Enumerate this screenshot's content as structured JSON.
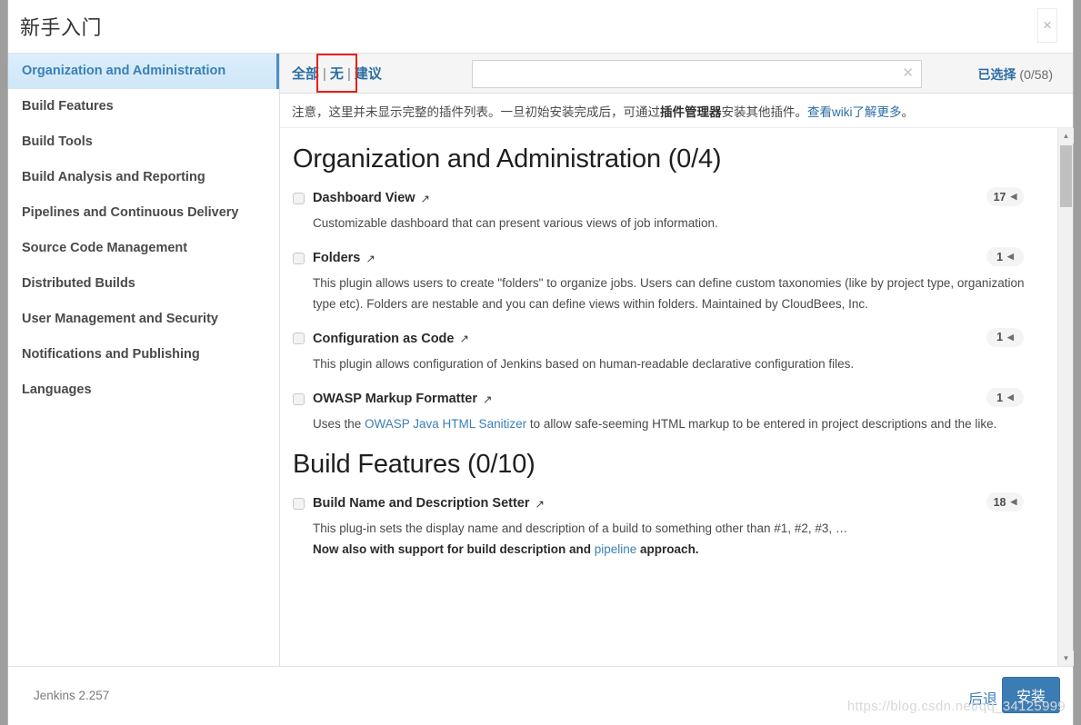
{
  "window": {
    "title": "新手入门",
    "close_label": "×"
  },
  "sidebar": {
    "items": [
      {
        "label": "Organization and Administration",
        "active": true
      },
      {
        "label": "Build Features",
        "active": false
      },
      {
        "label": "Build Tools",
        "active": false
      },
      {
        "label": "Build Analysis and Reporting",
        "active": false
      },
      {
        "label": "Pipelines and Continuous Delivery",
        "active": false
      },
      {
        "label": "Source Code Management",
        "active": false
      },
      {
        "label": "Distributed Builds",
        "active": false
      },
      {
        "label": "User Management and Security",
        "active": false
      },
      {
        "label": "Notifications and Publishing",
        "active": false
      },
      {
        "label": "Languages",
        "active": false
      }
    ]
  },
  "toolbar": {
    "filter_all": "全部",
    "filter_none": "无",
    "filter_suggested": "建议",
    "separator": "|",
    "search_value": "",
    "search_placeholder": "",
    "search_clear": "✕",
    "selected_label": "已选择",
    "selected_count": "(0/58)"
  },
  "notice": {
    "part1": "注意，这里并未显示完整的插件列表。一旦初始安装完成后，可通过",
    "bold": "插件管理器",
    "part2": "安装其他插件。",
    "link": "查看wiki了解更多",
    "part3": "。"
  },
  "sections": [
    {
      "title": "Organization and Administration (0/4)",
      "plugins": [
        {
          "name": "Dashboard View",
          "ext_icon": "↗",
          "badge": "17",
          "badge_arrow": "◀",
          "desc_pre": "Customizable dashboard that can present various views of job information.",
          "desc_link": "",
          "desc_post": "",
          "bold_line": ""
        },
        {
          "name": "Folders",
          "ext_icon": "↗",
          "badge": "1",
          "badge_arrow": "◀",
          "desc_pre": "This plugin allows users to create \"folders\" to organize jobs. Users can define custom taxonomies (like by project type, organization type etc). Folders are nestable and you can define views within folders. Maintained by CloudBees, Inc.",
          "desc_link": "",
          "desc_post": "",
          "bold_line": ""
        },
        {
          "name": "Configuration as Code",
          "ext_icon": "↗",
          "badge": "1",
          "badge_arrow": "◀",
          "desc_pre": "This plugin allows configuration of Jenkins based on human-readable declarative configuration files.",
          "desc_link": "",
          "desc_post": "",
          "bold_line": ""
        },
        {
          "name": "OWASP Markup Formatter",
          "ext_icon": "↗",
          "badge": "1",
          "badge_arrow": "◀",
          "desc_pre": "Uses the ",
          "desc_link": "OWASP Java HTML Sanitizer",
          "desc_post": " to allow safe-seeming HTML markup to be entered in project descriptions and the like.",
          "bold_line": ""
        }
      ]
    },
    {
      "title": "Build Features (0/10)",
      "plugins": [
        {
          "name": "Build Name and Description Setter",
          "ext_icon": "↗",
          "badge": "18",
          "badge_arrow": "◀",
          "desc_pre": "This plug-in sets the display name and description of a build to something other than #1, #2, #3, …",
          "desc_link": "",
          "desc_post": "",
          "bold_line_pre": "Now also with support for build description and ",
          "bold_line_link": "pipeline",
          "bold_line_post": " approach."
        }
      ]
    }
  ],
  "footer": {
    "version": "Jenkins 2.257",
    "back_label": "后退",
    "install_label": "安装",
    "watermark": "https://blog.csdn.net/qq_34125999"
  }
}
